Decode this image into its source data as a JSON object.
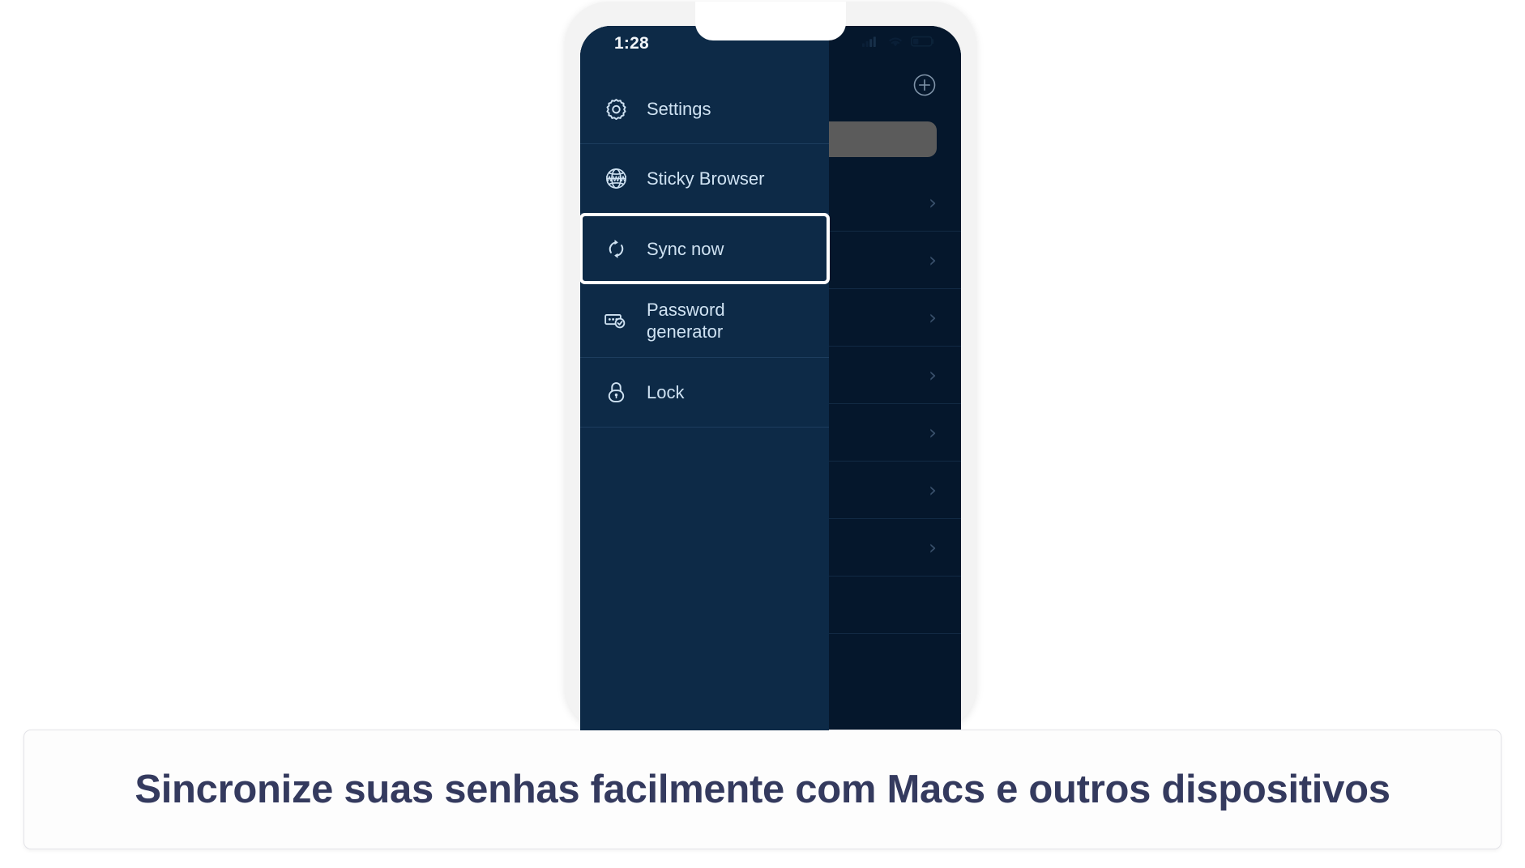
{
  "page": {
    "background_color": "#ffffff"
  },
  "caption": {
    "text": "Sincronize suas senhas facilmente com Macs e outros dispositivos",
    "color": "#343a5e"
  },
  "phone": {
    "frame_color": "#f3f3f3",
    "screen_color": "#05172c",
    "status_bar": {
      "time": "1:28",
      "icons": [
        "cellular-signal-icon",
        "wifi-icon",
        "battery-icon"
      ]
    }
  },
  "background_list": {
    "panel_color": "#05172c",
    "add_button_label": "+",
    "add_button_icon": "plus-circle-icon",
    "search_bar": {
      "value": "",
      "placeholder": "",
      "color": "#5b5b5b"
    },
    "rows": [
      {
        "chevron": "›"
      },
      {
        "chevron": "›"
      },
      {
        "chevron": "›"
      },
      {
        "chevron": "›"
      },
      {
        "chevron": "›"
      },
      {
        "chevron": "›"
      },
      {
        "chevron": "›"
      }
    ]
  },
  "drawer": {
    "panel_color": "#0d2a47",
    "text_color": "#cfe2f2",
    "highlight_color": "#ffffff",
    "items": [
      {
        "label": "Settings",
        "icon": "gear-icon",
        "selected": false
      },
      {
        "label": "Sticky Browser",
        "icon": "globe-www-icon",
        "selected": false
      },
      {
        "label": "Sync now",
        "icon": "sync-arrows-icon",
        "selected": true
      },
      {
        "label": "Password generator",
        "icon": "password-check-icon",
        "selected": false
      },
      {
        "label": "Lock",
        "icon": "lock-icon",
        "selected": false
      }
    ]
  }
}
